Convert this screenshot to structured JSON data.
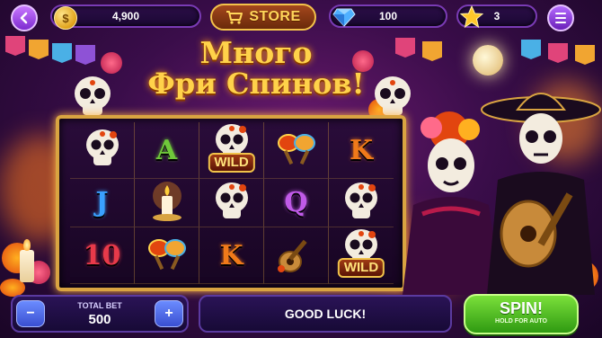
{
  "topbar": {
    "coins": "4,900",
    "coin_symbol": "$",
    "store_label": "STORE",
    "gems": "100",
    "stars": "3"
  },
  "title": {
    "line1": "Много",
    "line2": "Фри Спинов!"
  },
  "reels": [
    {
      "symbol": "skull",
      "label": ""
    },
    {
      "symbol": "letter",
      "label": "A",
      "color": "#6fc83a"
    },
    {
      "symbol": "wild",
      "label": "WILD"
    },
    {
      "symbol": "maracas",
      "label": ""
    },
    {
      "symbol": "letter",
      "label": "K",
      "color": "#f07a1a"
    },
    {
      "symbol": "letter",
      "label": "J",
      "color": "#3aa0ff"
    },
    {
      "symbol": "candle",
      "label": ""
    },
    {
      "symbol": "skull",
      "label": ""
    },
    {
      "symbol": "letter",
      "label": "Q",
      "color": "#c05ae8"
    },
    {
      "symbol": "skull",
      "label": ""
    },
    {
      "symbol": "letter",
      "label": "10",
      "color": "#e83a4a"
    },
    {
      "symbol": "maracas",
      "label": ""
    },
    {
      "symbol": "letter",
      "label": "K",
      "color": "#f07a1a"
    },
    {
      "symbol": "guitar",
      "label": ""
    },
    {
      "symbol": "wild",
      "label": "WILD"
    }
  ],
  "bottom": {
    "bet_label": "TOTAL BET",
    "bet_value": "500",
    "minus": "−",
    "plus": "+",
    "message": "GOOD LUCK!",
    "spin_label": "SPIN!",
    "spin_sub": "HOLD FOR AUTO"
  },
  "colors": {
    "accent_gold": "#ffd24a",
    "spin_green": "#4cc21f",
    "bet_blue": "#4a63e6"
  }
}
